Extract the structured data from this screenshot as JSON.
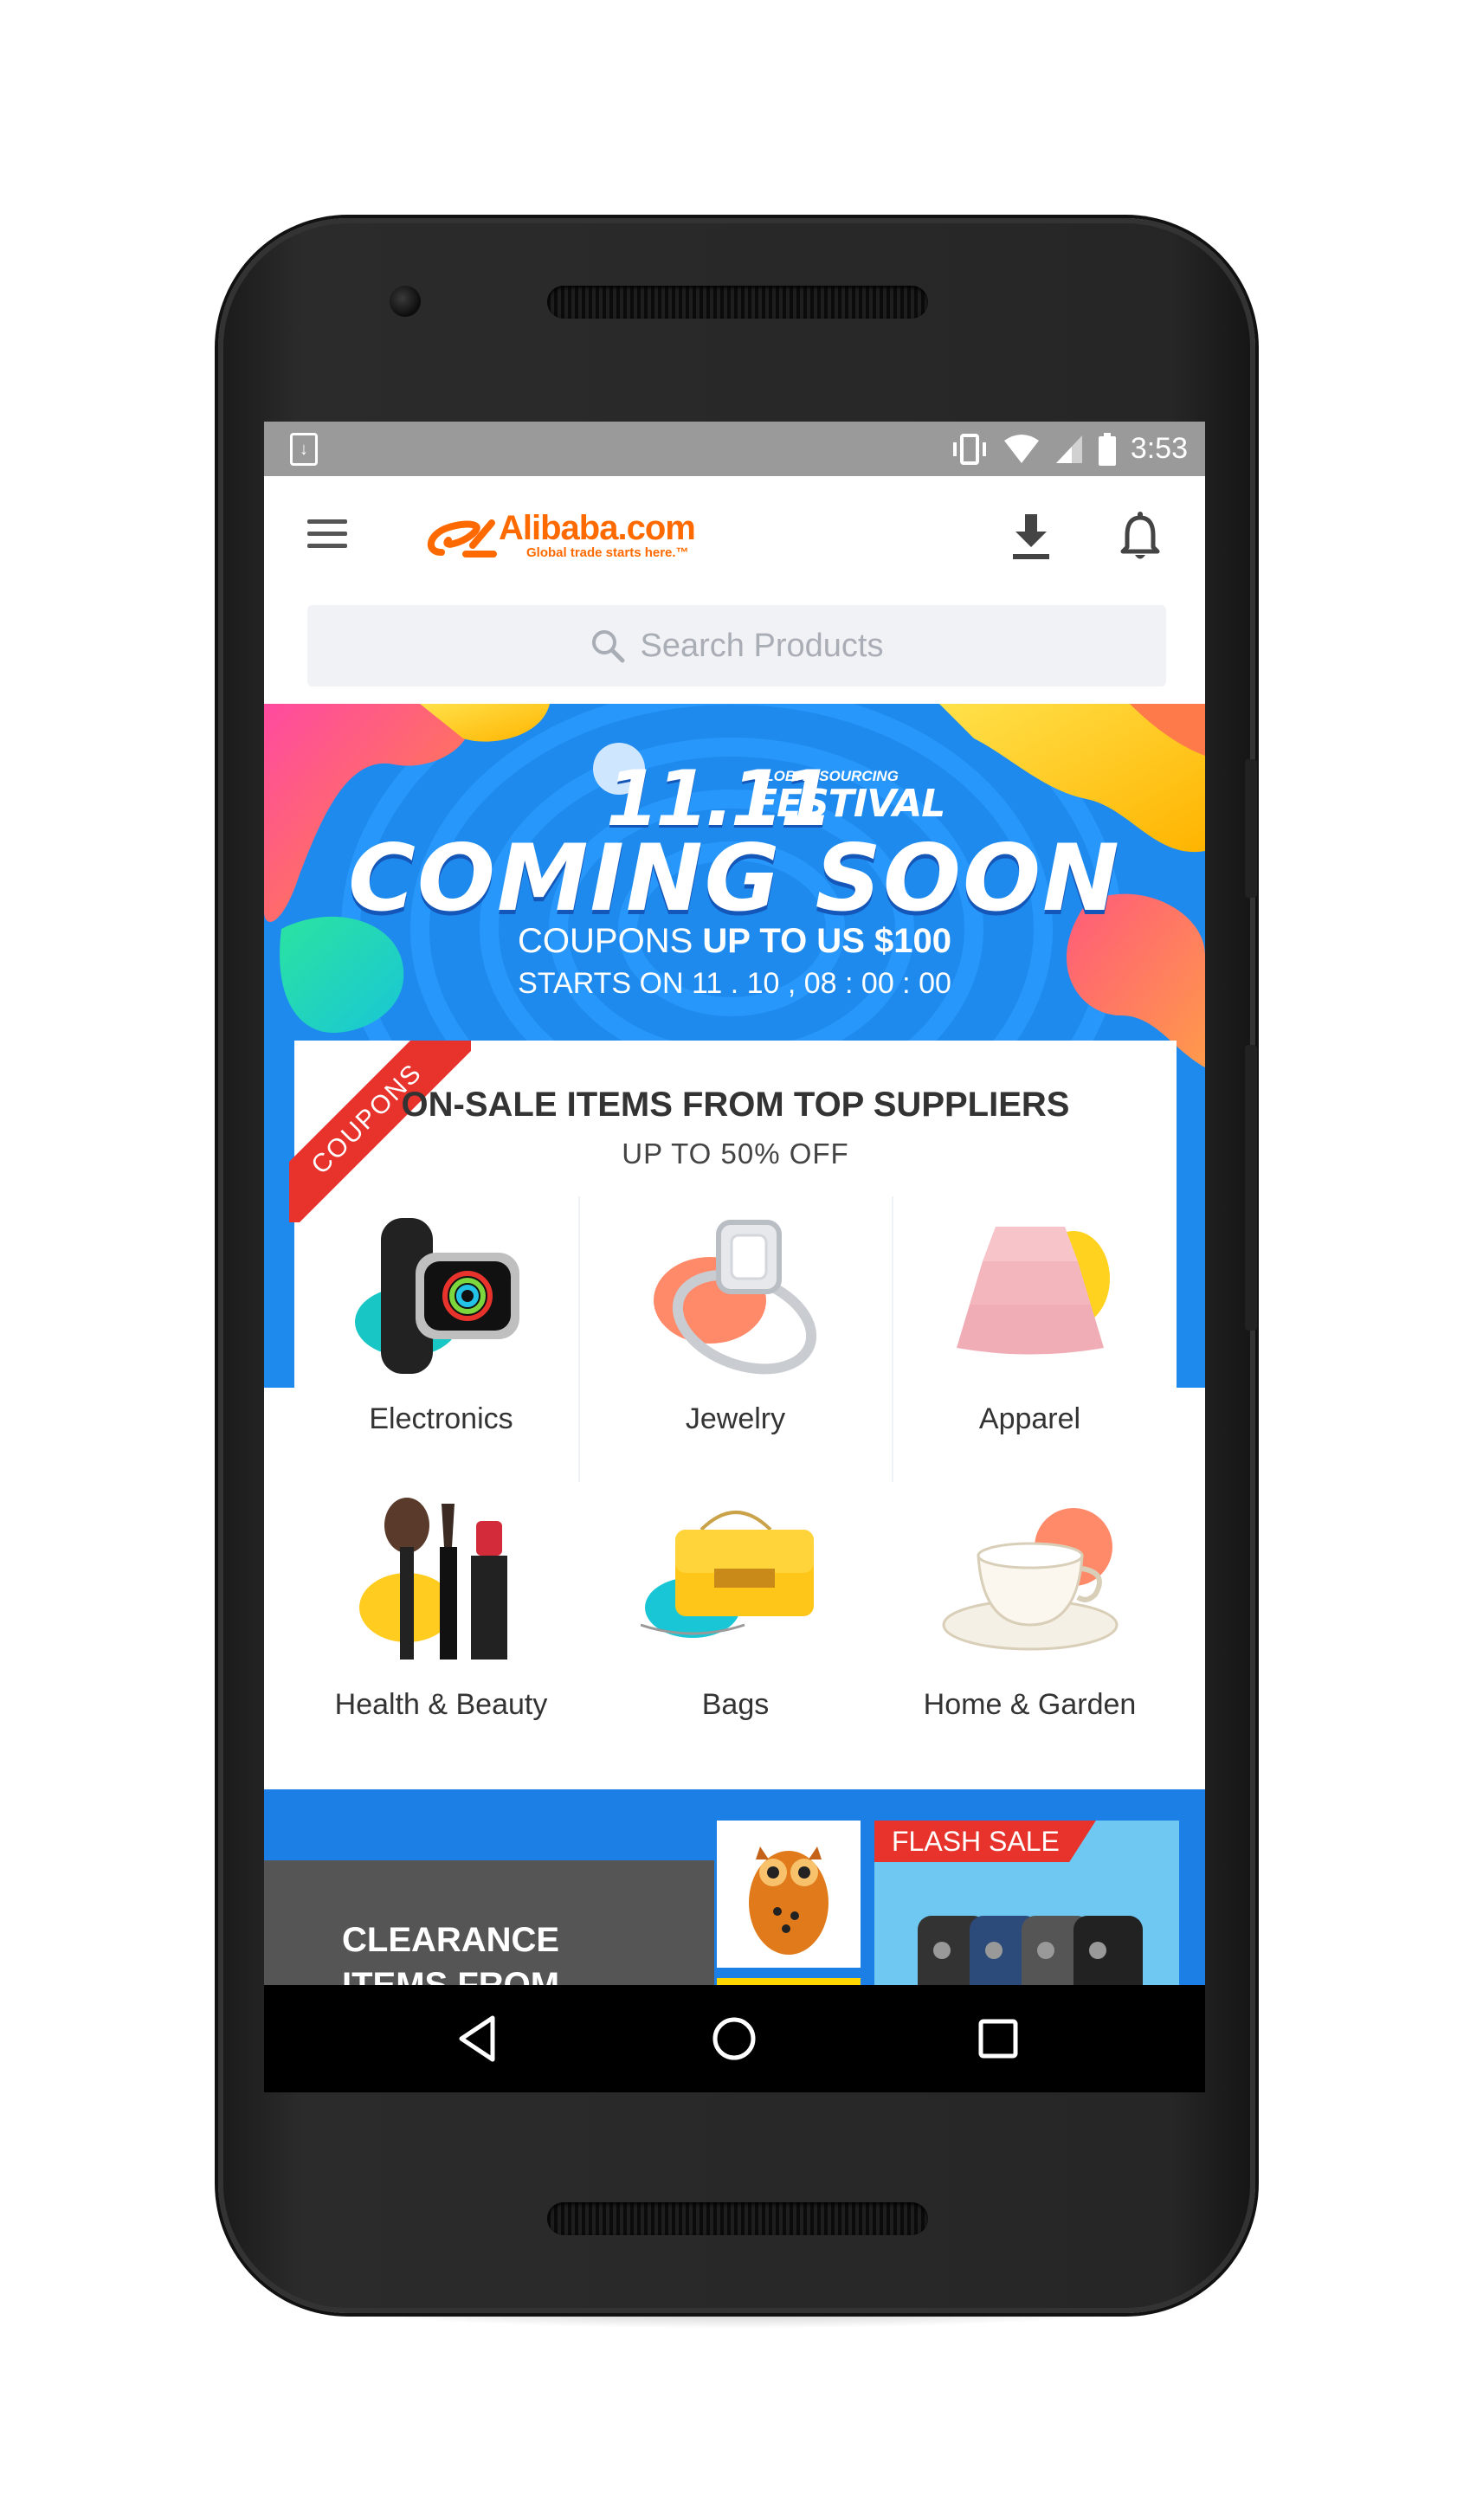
{
  "status_bar": {
    "time": "3:53"
  },
  "app_bar": {
    "logo_text": "Alibaba.com",
    "logo_tagline": "Global trade starts here.™",
    "icons": [
      "menu-icon",
      "download-icon",
      "bell-icon"
    ]
  },
  "search": {
    "placeholder": "Search Products"
  },
  "banner": {
    "festival_number": "11.11",
    "festival_small": "GLOBAL SOURCING",
    "festival_big": "FESTIVAL",
    "headline": "COMING SOON",
    "coupons_prefix": "COUPONS",
    "coupons_value": "UP TO US $100",
    "starts": "STARTS ON 11 . 10 , 08 : 00 : 00"
  },
  "on_sale": {
    "ribbon": "COUPONS",
    "title": "ON-SALE ITEMS FROM TOP SUPPLIERS",
    "subtitle": "UP TO 50% OFF",
    "categories": [
      {
        "label": "Electronics"
      },
      {
        "label": "Jewelry"
      },
      {
        "label": "Apparel"
      },
      {
        "label": "Health & Beauty"
      },
      {
        "label": "Bags"
      },
      {
        "label": "Home & Garden"
      }
    ]
  },
  "promos": {
    "clearance_line1": "CLEARANCE",
    "clearance_line2": "ITEMS FROM",
    "flash_sale": "FLASH SALE"
  },
  "colors": {
    "brand_orange": "#ff6a00",
    "banner_blue": "#1b7fe5",
    "ribbon_red": "#e8332d"
  }
}
